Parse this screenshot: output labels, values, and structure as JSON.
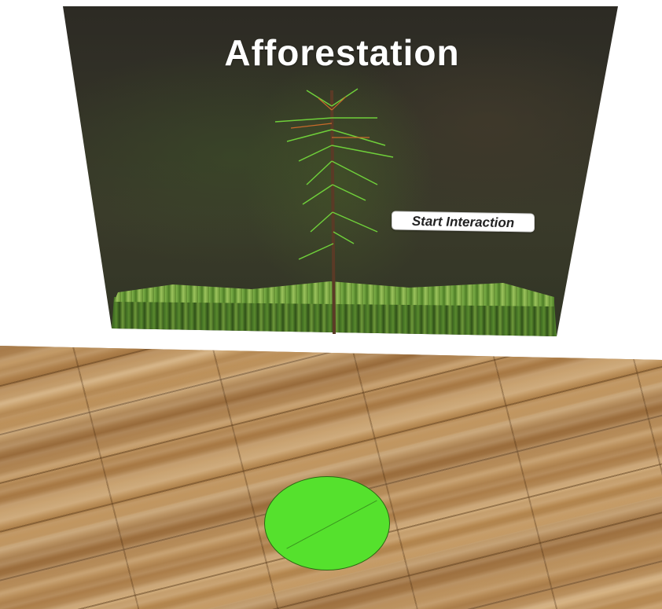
{
  "billboard": {
    "title": "Afforestation",
    "start_button_label": "Start Interaction"
  },
  "floor": {
    "material": "wood-planks"
  },
  "marker": {
    "color": "#55e12d"
  },
  "colors": {
    "title_text": "#ffffff",
    "button_background": "#ffffff",
    "button_text": "#222222"
  }
}
